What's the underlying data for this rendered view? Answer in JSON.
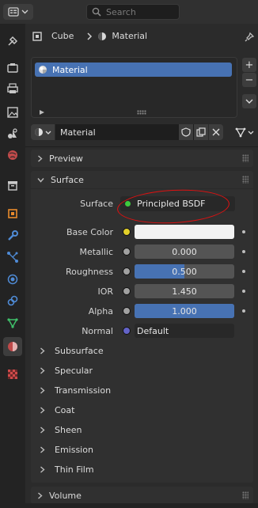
{
  "topbar": {
    "search_placeholder": "Search"
  },
  "header": {
    "object_name": "Cube",
    "context_name": "Material"
  },
  "slots": {
    "items": [
      "Material"
    ]
  },
  "datablock": {
    "material_name": "Material"
  },
  "panels": {
    "preview": "Preview",
    "surface": "Surface",
    "volume": "Volume"
  },
  "surface": {
    "shader_label": "Surface",
    "shader_value": "Principled BSDF",
    "props": [
      {
        "label": "Base Color",
        "value": "",
        "socket": "#e2d02a",
        "kind": "color",
        "swatch": "#f2f2f2"
      },
      {
        "label": "Metallic",
        "value": "0.000",
        "socket": "#a1a1a1",
        "kind": "number",
        "fill": 0.0
      },
      {
        "label": "Roughness",
        "value": "0.500",
        "socket": "#a1a1a1",
        "kind": "number",
        "fill": 0.5
      },
      {
        "label": "IOR",
        "value": "1.450",
        "socket": "#a1a1a1",
        "kind": "number",
        "fill": 0.0
      },
      {
        "label": "Alpha",
        "value": "1.000",
        "socket": "#a1a1a1",
        "kind": "number",
        "fill": 1.0
      },
      {
        "label": "Normal",
        "value": "Default",
        "socket": "#6363c7",
        "kind": "vector"
      }
    ],
    "subpanels": [
      "Subsurface",
      "Specular",
      "Transmission",
      "Coat",
      "Sheen",
      "Emission",
      "Thin Film"
    ]
  },
  "colors": {
    "accent": "#4772b3",
    "annotation": "#d11111",
    "shader_socket": "#3ec93e"
  }
}
